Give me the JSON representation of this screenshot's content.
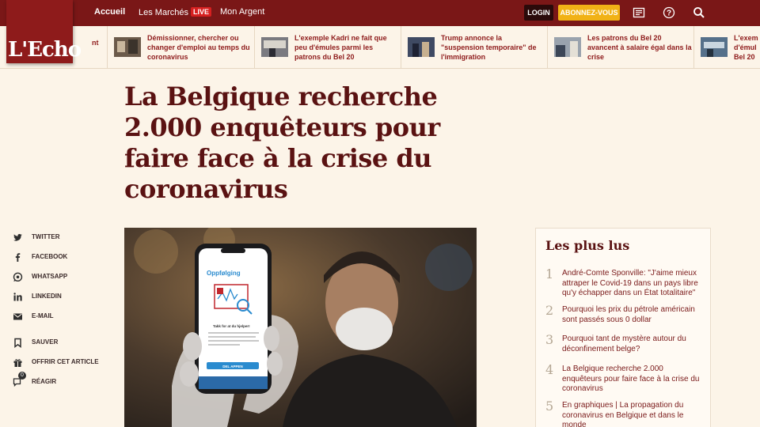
{
  "brand": {
    "logo_text": "L'Echo"
  },
  "nav": {
    "home": "Accueil",
    "markets": "Les Marchés",
    "live": "LIVE",
    "money": "Mon Argent",
    "login": "LOGIN",
    "subscribe": "ABONNEZ-VOUS"
  },
  "ticker": {
    "partial_left": "nt",
    "items": [
      {
        "text": "Démissionner, chercher ou changer d'emploi au temps du coronavirus"
      },
      {
        "text": "L'exemple Kadri ne fait que peu d'émules parmi les patrons du Bel 20"
      },
      {
        "text": "Trump annonce la \"suspension temporaire\" de l'immigration"
      },
      {
        "text": "Les patrons du Bel 20 avancent à salaire égal dans la crise"
      },
      {
        "text": "L'exem d'émul Bel 20"
      }
    ]
  },
  "article": {
    "title": "La Belgique recherche 2.000 enquêteurs pour faire face à la crise du coronavirus"
  },
  "phone_screen": {
    "heading": "Oppfølging",
    "line1": "Takk for at du hjelper!",
    "button": "DEL APPEN"
  },
  "share": {
    "twitter": "TWITTER",
    "facebook": "FACEBOOK",
    "whatsapp": "WHATSAPP",
    "linkedin": "LINKEDIN",
    "email": "E-MAIL",
    "save": "SAUVER",
    "offer": "OFFRIR CET ARTICLE",
    "react": "RÉAGIR",
    "react_count": "0"
  },
  "most_read": {
    "title": "Les plus lus",
    "items": [
      {
        "num": "1",
        "text": "André-Comte Sponville: \"J'aime mieux attraper le Covid-19 dans un pays libre qu'y échapper dans un État totalitaire\""
      },
      {
        "num": "2",
        "text": "Pourquoi les prix du pétrole américain sont passés sous 0 dollar"
      },
      {
        "num": "3",
        "text": "Pourquoi tant de mystère autour du déconfinement belge?"
      },
      {
        "num": "4",
        "text": "La Belgique recherche 2.000 enquêteurs pour faire face à la crise du coronavirus"
      },
      {
        "num": "5",
        "text": "En graphiques | La propagation du coronavirus en Belgique et dans le monde"
      }
    ]
  },
  "colors": {
    "brand_red": "#7a1717",
    "accent_yellow": "#f1b216",
    "live_red": "#d62020",
    "page_bg": "#fcf4e8"
  }
}
